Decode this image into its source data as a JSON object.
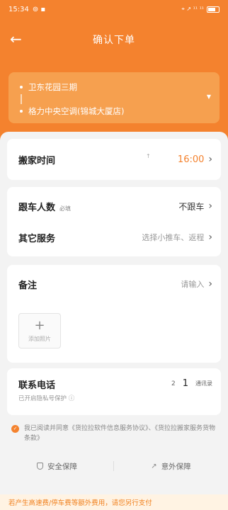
{
  "status_bar": {
    "time": "15:34",
    "indicators": "⊚ ▪",
    "network": "⌖ ↗ ¹¹ ¹¹"
  },
  "nav": {
    "back_icon": "←",
    "title": "确认下单"
  },
  "route": {
    "start": "卫东花园三期",
    "end": "格力中央空调(锦城大厦店)",
    "expand_icon": "▼"
  },
  "moving_time": {
    "label": "搬家时间",
    "value": "16:00",
    "hint_mark": "↑"
  },
  "riders": {
    "label": "跟车人数",
    "badge": "必填",
    "value": "不跟车"
  },
  "other_services": {
    "label": "其它服务",
    "value": "选择小推车、返程"
  },
  "remarks": {
    "label": "备注",
    "value": "请输入",
    "add_photo_icon": "+",
    "add_photo_label": "添加照片"
  },
  "phone": {
    "label": "联系电话",
    "sub": "已开启隐私号保护 ⓘ",
    "code": "2",
    "number": "1",
    "contacts": "通讯录"
  },
  "agreement": {
    "text": "我已阅读并同意《货拉拉软件信息服务协议》、《货拉拉搬家服务货物条款》",
    "check_icon": "✓"
  },
  "safety": {
    "left": "安全保障",
    "right": "意外保障",
    "ext_icon": "↗"
  },
  "notice": "若产生高速费/停车费等额外费用，请您另行支付",
  "chevron": "›",
  "colors": {
    "accent": "#f4822e",
    "route_card": "#f6a04f",
    "notice_bg": "#fff3e3"
  }
}
